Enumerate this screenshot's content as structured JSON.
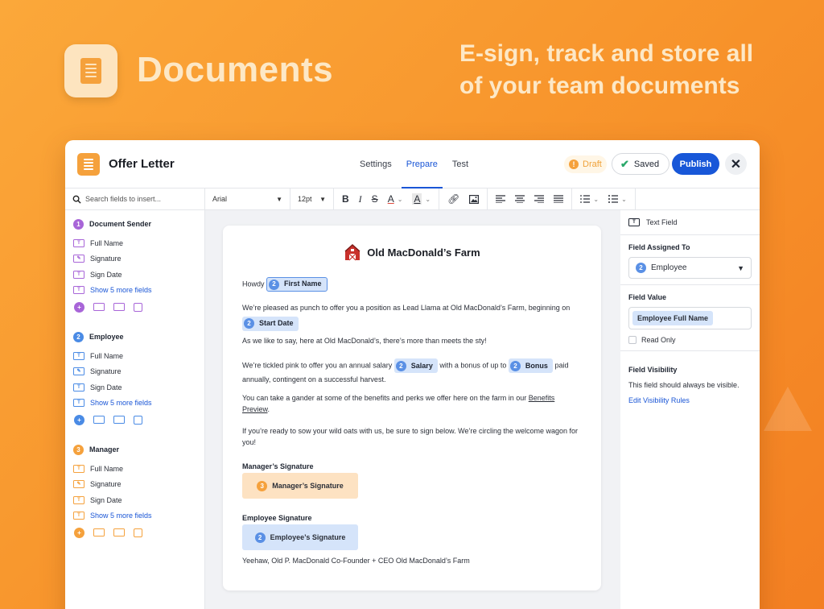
{
  "hero": {
    "title": "Documents",
    "tagline": "E-sign, track and store all of your team documents"
  },
  "header": {
    "doc_title": "Offer Letter",
    "tabs": [
      {
        "label": "Settings"
      },
      {
        "label": "Prepare"
      },
      {
        "label": "Test"
      }
    ],
    "status": "Draft",
    "saved": "Saved",
    "publish": "Publish"
  },
  "toolbar": {
    "search_placeholder": "Search fields to insert...",
    "font": "Arial",
    "size": "12pt"
  },
  "sidebar": {
    "groups": [
      {
        "num": "1",
        "name": "Document Sender",
        "color": "#a865d8",
        "items": [
          "Full Name",
          "Signature",
          "Sign Date"
        ],
        "more": "Show 5 more fields"
      },
      {
        "num": "2",
        "name": "Employee",
        "color": "#4a8be5",
        "items": [
          "Full Name",
          "Signature",
          "Sign Date"
        ],
        "more": "Show 5 more fields"
      },
      {
        "num": "3",
        "name": "Manager",
        "color": "#f5a13c",
        "items": [
          "Full Name",
          "Signature",
          "Sign Date"
        ],
        "more": "Show 5 more fields"
      }
    ]
  },
  "document": {
    "company": "Old MacDonald’s Farm",
    "greeting": "Howdy",
    "first_name_chip": "First Name",
    "p1": "We’re pleased as punch to offer you a position as Lead Llama at Old MacDonald’s Farm, beginning on",
    "start_date_chip": "Start Date",
    "p2": "As we like to say, here at Old MacDonald’s, there’s more than meets the sty!",
    "p3a": "We’re tickled pink to offer you an annual salary",
    "salary_chip": "Salary",
    "p3b": "with a bonus of up to",
    "bonus_chip": "Bonus",
    "p3c": "paid",
    "p3d": "annually, contingent on a successful harvest.",
    "p4a": "You can take a gander at some of the benefits and perks we offer here on the farm in our",
    "p4link1": "Benefits",
    "p4link2": "Preview",
    "p4b": ".",
    "p5": "If you’re ready to sow your wild oats with us, be sure to sign below. We’re circling the welcome wagon for you!",
    "mgr_label": "Manager’s Signature",
    "mgr_chip": "Manager’s Signature",
    "emp_label": "Employee Signature",
    "emp_chip": "Employee’s Signature",
    "footer": "Yeehaw, Old P. MacDonald Co-Founder + CEO Old MacDonald’s Farm",
    "badge2": "2",
    "badge3": "3"
  },
  "right_panel": {
    "field_type": "Text Field",
    "assigned_label": "Field Assigned To",
    "assigned_num": "2",
    "assigned_value": "Employee",
    "value_label": "Field Value",
    "value_chip": "Employee Full Name",
    "read_only": "Read Only",
    "visibility_label": "Field Visibility",
    "visibility_text": "This field should always be visible.",
    "visibility_link": "Edit Visibility Rules"
  },
  "colors": {
    "accent": "#1857d8",
    "orange": "#f5a13c",
    "purple": "#a865d8",
    "blue": "#4a8be5"
  }
}
